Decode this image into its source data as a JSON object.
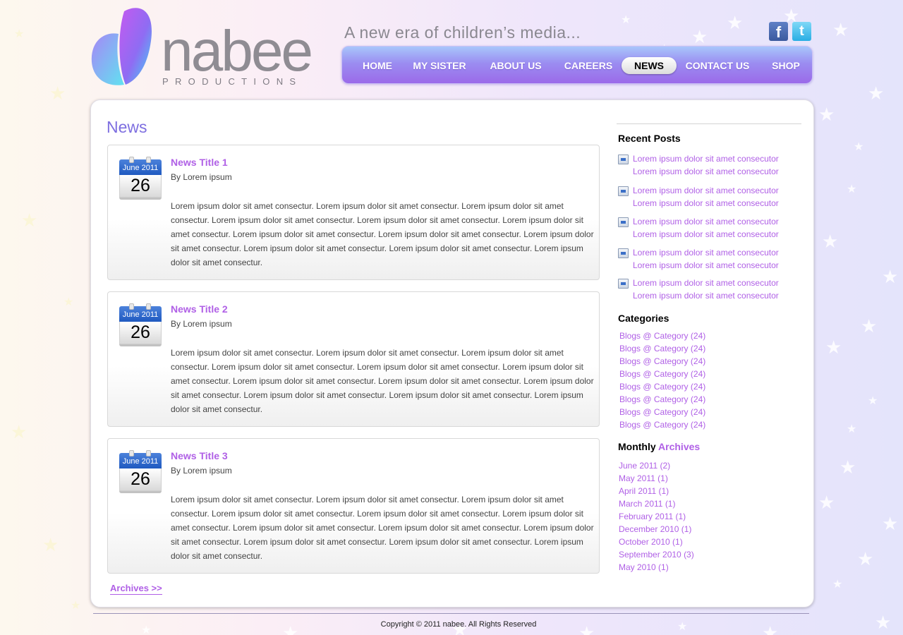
{
  "brand": {
    "logo_word": "nabee",
    "logo_sub": "PRODUCTIONS",
    "tagline": "A new era of children’s media..."
  },
  "social": {
    "facebook": "f",
    "twitter": "t"
  },
  "nav": [
    {
      "label": "HOME",
      "active": false
    },
    {
      "label": "MY SISTER",
      "active": false
    },
    {
      "label": "ABOUT US",
      "active": false
    },
    {
      "label": "CAREERS",
      "active": false
    },
    {
      "label": "NEWS",
      "active": true
    },
    {
      "label": "CONTACT US",
      "active": false
    },
    {
      "label": "SHOP",
      "active": false
    }
  ],
  "page": {
    "title": "News",
    "archives_link": "Archives >>"
  },
  "news": [
    {
      "title": "News Title 1",
      "by": "By Lorem ipsum",
      "month": "June 2011",
      "day": "26",
      "body": "Lorem ipsum dolor sit amet consectur. Lorem ipsum dolor sit amet consectur. Lorem ipsum dolor sit amet consectur. Lorem ipsum dolor sit amet consectur. Lorem ipsum dolor sit amet consectur. Lorem ipsum dolor sit amet consectur. Lorem ipsum dolor sit amet consectur. Lorem ipsum dolor sit amet consectur. Lorem ipsum dolor sit amet consectur. Lorem ipsum dolor sit amet consectur. Lorem ipsum dolor sit amet consectur. Lorem ipsum dolor sit amet consectur."
    },
    {
      "title": "News Title 2",
      "by": "By Lorem ipsum",
      "month": "June 2011",
      "day": "26",
      "body": "Lorem ipsum dolor sit amet consectur. Lorem ipsum dolor sit amet consectur. Lorem ipsum dolor sit amet consectur. Lorem ipsum dolor sit amet consectur. Lorem ipsum dolor sit amet consectur. Lorem ipsum dolor sit amet consectur. Lorem ipsum dolor sit amet consectur. Lorem ipsum dolor sit amet consectur. Lorem ipsum dolor sit amet consectur. Lorem ipsum dolor sit amet consectur. Lorem ipsum dolor sit amet consectur. Lorem ipsum dolor sit amet consectur."
    },
    {
      "title": "News Title 3",
      "by": "By Lorem ipsum",
      "month": "June 2011",
      "day": "26",
      "body": "Lorem ipsum dolor sit amet consectur. Lorem ipsum dolor sit amet consectur. Lorem ipsum dolor sit amet consectur. Lorem ipsum dolor sit amet consectur. Lorem ipsum dolor sit amet consectur. Lorem ipsum dolor sit amet consectur. Lorem ipsum dolor sit amet consectur. Lorem ipsum dolor sit amet consectur. Lorem ipsum dolor sit amet consectur. Lorem ipsum dolor sit amet consectur. Lorem ipsum dolor sit amet consectur. Lorem ipsum dolor sit amet consectur."
    }
  ],
  "sidebar": {
    "recent_heading": "Recent Posts",
    "recent_posts": [
      {
        "line1": "Lorem ipsum dolor sit amet consecutor",
        "line2": "Lorem ipsum dolor sit amet consecutor"
      },
      {
        "line1": "Lorem ipsum dolor sit amet consecutor",
        "line2": "Lorem ipsum dolor sit amet consecutor"
      },
      {
        "line1": "Lorem ipsum dolor sit amet consecutor",
        "line2": "Lorem ipsum dolor sit amet consecutor"
      },
      {
        "line1": "Lorem ipsum dolor sit amet consecutor",
        "line2": "Lorem ipsum dolor sit amet consecutor"
      },
      {
        "line1": "Lorem ipsum dolor sit amet consecutor",
        "line2": "Lorem ipsum dolor sit amet consecutor"
      }
    ],
    "categories_heading": "Categories",
    "categories": [
      "Blogs @ Category (24)",
      "Blogs @ Category (24)",
      "Blogs @ Category (24)",
      "Blogs @ Category (24)",
      "Blogs @ Category (24)",
      "Blogs @ Category (24)",
      "Blogs @ Category (24)",
      "Blogs @ Category (24)"
    ],
    "archives_heading_1": "Monthly",
    "archives_heading_2": "Archives",
    "archives": [
      "June 2011 (2)",
      "May 2011 (1)",
      "April 2011 (1)",
      "March 2011 (1)",
      "February 2011 (1)",
      "December 2010 (1)",
      "October 2010 (1)",
      "September 2010 (3)",
      "May 2010 (1)"
    ]
  },
  "footer": {
    "copyright": "Copyright © 2011 nabee. All Rights Reserved"
  },
  "colors": {
    "accent": "#b060e6",
    "title": "#7e6fe0",
    "nav_top": "#a8c6fb",
    "nav_bottom": "#9b6ae9"
  }
}
